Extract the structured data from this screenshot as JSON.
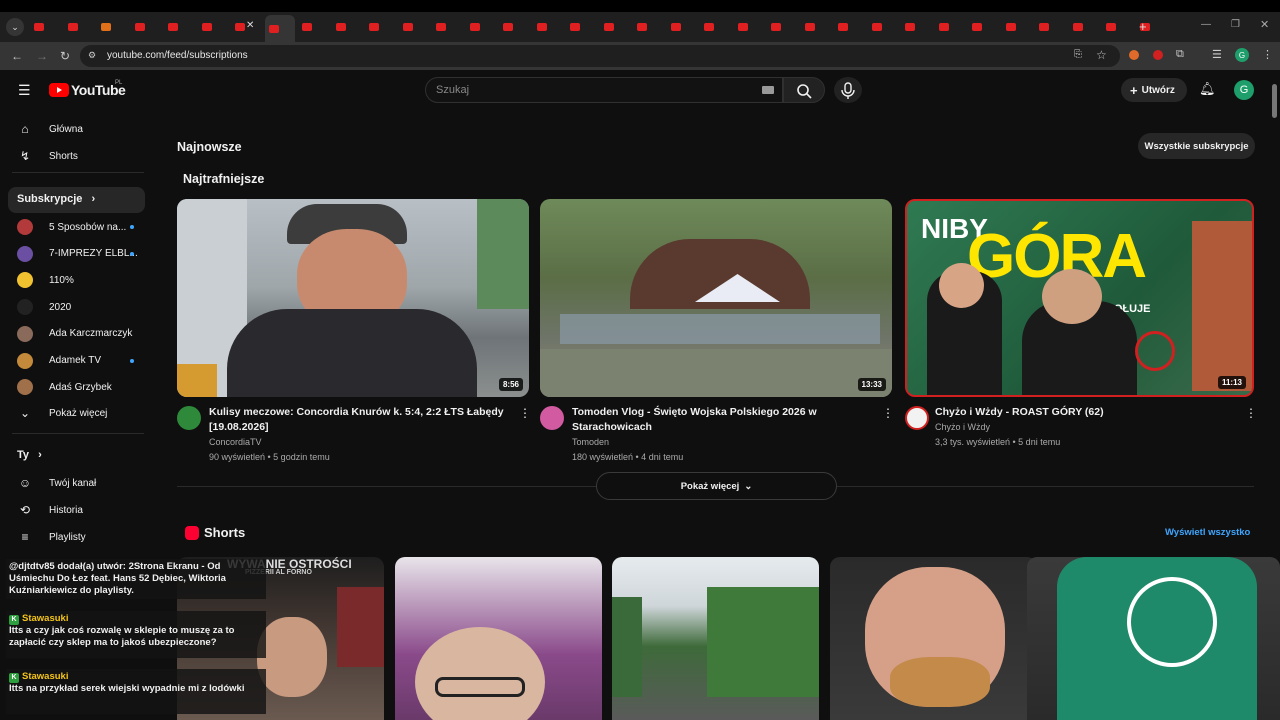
{
  "browser": {
    "url": "youtube.com/feed/subscriptions",
    "tab_count": 34
  },
  "header": {
    "logo": "YouTube",
    "region": "PL",
    "search_placeholder": "Szukaj",
    "create_label": "Utwórz",
    "avatar_letter": "G"
  },
  "sidebar": {
    "home": "Główna",
    "shorts": "Shorts",
    "subscriptions_label": "Subskrypcje",
    "subs": [
      {
        "name": "5 Sposobów na...",
        "color": "#b23a3a",
        "dot": true
      },
      {
        "name": "7-IMPREZY ELBL...",
        "color": "#6b4fa3",
        "dot": true
      },
      {
        "name": "110%",
        "color": "#f0c230",
        "dot": false
      },
      {
        "name": "2020",
        "color": "#222222",
        "dot": false
      },
      {
        "name": "Ada Karczmarczyk",
        "color": "#8a6a5a",
        "dot": false
      },
      {
        "name": "Adamek TV",
        "color": "#c28a3a",
        "dot": true
      },
      {
        "name": "Adaś Grzybek",
        "color": "#a0704a",
        "dot": false
      }
    ],
    "show_more": "Pokaż więcej",
    "you_label": "Ty",
    "your_channel": "Twój kanał",
    "history": "Historia",
    "playlists": "Playlisty"
  },
  "main": {
    "latest_heading": "Najnowsze",
    "all_subs_button": "Wszystkie subskrypcje",
    "relevant_heading": "Najtrafniejsze",
    "show_more": "Pokaż więcej",
    "shorts_heading": "Shorts",
    "view_all": "Wyświetl wszystko",
    "videos": [
      {
        "title": "Kulisy meczowe: Concordia Knurów k. 5:4, 2:2 ŁTS Łabędy [19.08.2026]",
        "channel": "ConcordiaTV",
        "meta": "90 wyświetleń • 5 godzin temu",
        "duration": "8:56"
      },
      {
        "title": "Tomoden Vlog - Święto Wojska Polskiego 2026 w Starachowicach",
        "channel": "Tomoden",
        "meta": "180 wyświetleń • 4 dni temu",
        "duration": "13:33"
      },
      {
        "title": "Chyżo i Wżdy - ROAST GÓRY (62)",
        "channel": "Chyżo i Wżdy",
        "meta": "3,3 tys. wyświetleń • 5 dni temu",
        "duration": "11:13"
      }
    ],
    "thumb3_text": {
      "top": "NIBY",
      "big": "GÓRA",
      "sub": "A JEDNAK DOŁUJE"
    },
    "short1_text": {
      "top": "WYWANIE OSTROŚCI",
      "sub": "PIZZERII AL FORNO"
    }
  },
  "chat": [
    {
      "text": "@djtdtv85 dodał(a) utwór: 2Strona Ekranu - Od Uśmiechu Do Łez feat. Hans 52 Dębiec, Wiktoria Kuźniarkiewicz do playlisty."
    },
    {
      "name": "Stawasuki",
      "text": "Itts a czy jak coś rozwalę w sklepie to muszę za to zapłacić czy sklep ma to jakoś ubezpieczone?"
    },
    {
      "name": "Stawasuki",
      "text": "Itts na przykład serek wiejski wypadnie mi z lodówki"
    }
  ]
}
